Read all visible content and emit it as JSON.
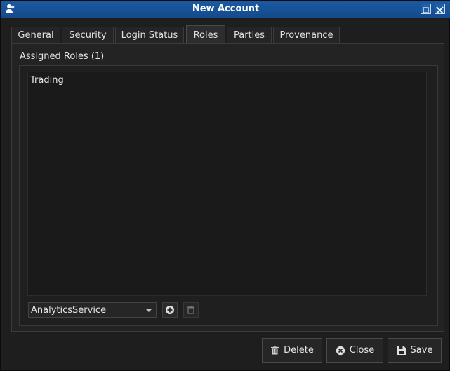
{
  "window": {
    "title": "New Account",
    "icons": {
      "app": "users-icon",
      "minmax": "minimize-maximize-icon",
      "close": "close-icon"
    }
  },
  "tabs": [
    {
      "label": "General",
      "active": false
    },
    {
      "label": "Security",
      "active": false
    },
    {
      "label": "Login Status",
      "active": false
    },
    {
      "label": "Roles",
      "active": true
    },
    {
      "label": "Parties",
      "active": false
    },
    {
      "label": "Provenance",
      "active": false
    }
  ],
  "roles": {
    "group_label": "Assigned Roles (1)",
    "items": [
      "Trading"
    ],
    "combo_value": "AnalyticsService",
    "add_icon": "plus-circle-icon",
    "remove_icon": "trash-icon"
  },
  "footer": {
    "delete_label": "Delete",
    "close_label": "Close",
    "save_label": "Save",
    "delete_icon": "trash-icon",
    "close_icon": "x-circle-icon",
    "save_icon": "floppy-disk-icon"
  },
  "colors": {
    "titlebar": "#1b5aa4",
    "background": "#1e1e1e",
    "text": "#e6e6e6"
  }
}
